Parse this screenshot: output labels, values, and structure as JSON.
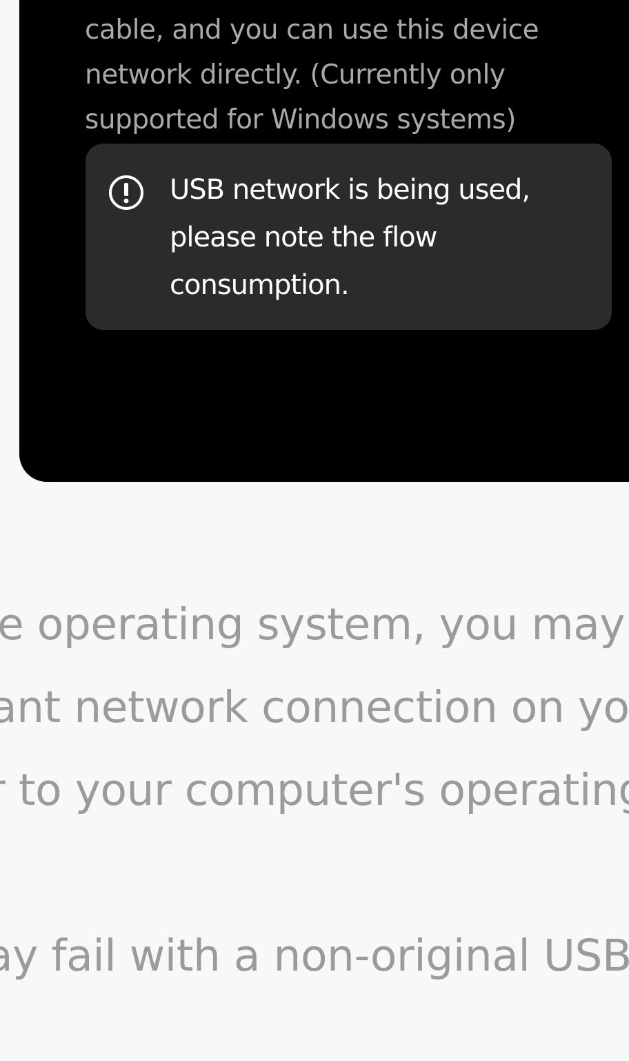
{
  "usb_network_panel": {
    "description": "connects to this device via a USB\ncable, and you can use this device\nnetwork directly. (Currently only\nsupported for Windows systems)",
    "warning": {
      "icon": "exclamation-circle-icon",
      "text": "USB network is being used, please note the flow consumption."
    }
  },
  "background_text": {
    "lines": [
      "e operating system, you may",
      "ant network connection on yo",
      "r to your computer's operating",
      "ay fail with a non-original USB"
    ]
  },
  "colors": {
    "page_background": "#f8f8f8",
    "card_background": "#000000",
    "warning_background": "#2b2b2b",
    "description_text": "#a9a9a9",
    "warning_text": "#ffffff",
    "body_text": "#9b9b9b"
  }
}
